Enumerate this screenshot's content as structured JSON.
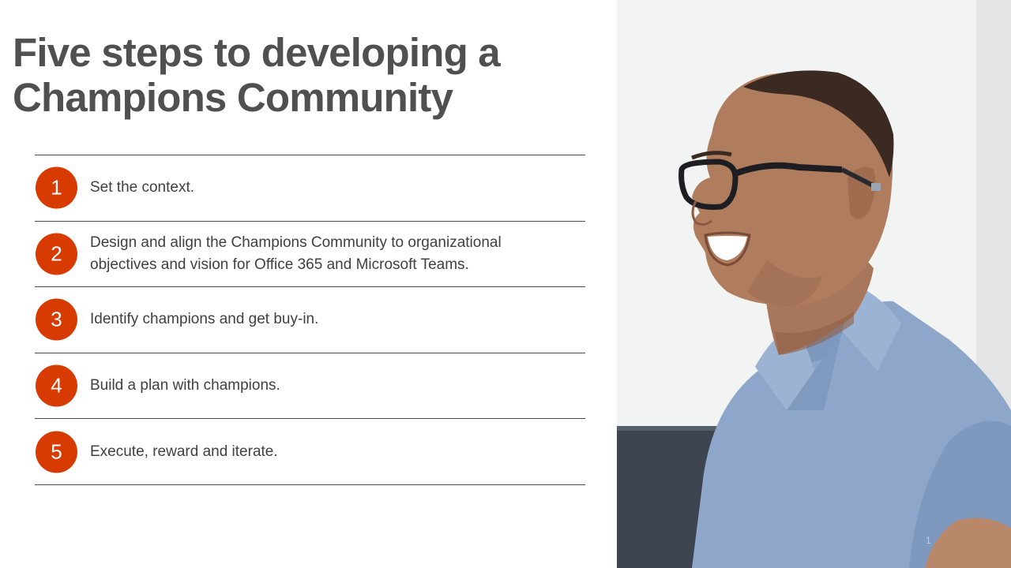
{
  "slide": {
    "title_line1": "Five steps to developing a",
    "title_line2": "Champions Community",
    "steps": [
      {
        "number": "1",
        "text": "Set the context."
      },
      {
        "number": "2",
        "text": "Design and align the Champions Community to organizational objectives and vision for Office 365 and Microsoft Teams."
      },
      {
        "number": "3",
        "text": "Identify champions and get buy-in."
      },
      {
        "number": "4",
        "text": "Build a plan with champions."
      },
      {
        "number": "5",
        "text": "Execute, reward and iterate."
      }
    ],
    "page_number": "1"
  },
  "colors": {
    "accent": "#d83b01",
    "title": "#505050",
    "text": "#404040",
    "divider": "#4a4a4a"
  },
  "photo": {
    "subject": "smiling man with glasses in blue polo shirt"
  }
}
